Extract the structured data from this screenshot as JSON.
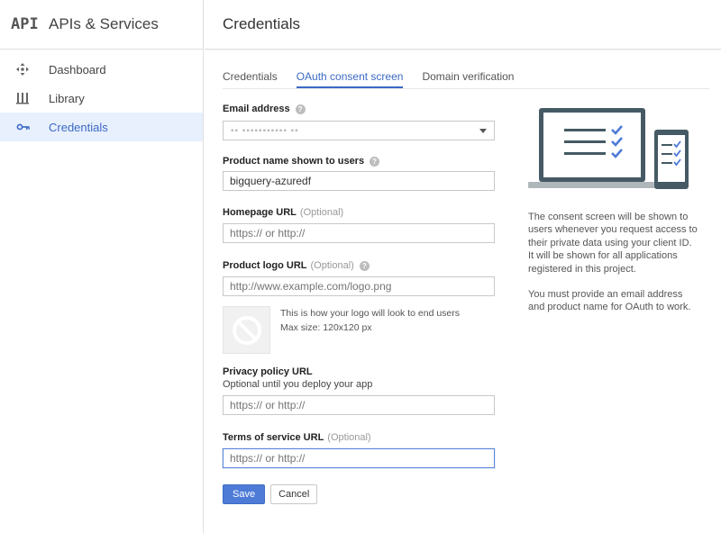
{
  "sidebar": {
    "logo": "API",
    "title": "APIs & Services",
    "items": [
      {
        "label": "Dashboard",
        "icon": "dashboard-icon",
        "active": false
      },
      {
        "label": "Library",
        "icon": "library-icon",
        "active": false
      },
      {
        "label": "Credentials",
        "icon": "key-icon",
        "active": true
      }
    ]
  },
  "header": {
    "title": "Credentials"
  },
  "tabs": [
    {
      "label": "Credentials",
      "active": false
    },
    {
      "label": "OAuth consent screen",
      "active": true
    },
    {
      "label": "Domain verification",
      "active": false
    }
  ],
  "form": {
    "email": {
      "label": "Email address",
      "value": "▪▪ ▪▪▪▪▪▪▪▪▪▪▪ ▪▪"
    },
    "product_name": {
      "label": "Product name shown to users",
      "value": "bigquery-azuredf"
    },
    "homepage": {
      "label": "Homepage URL",
      "optional": "(Optional)",
      "placeholder": "https:// or http://"
    },
    "logo_url": {
      "label": "Product logo URL",
      "optional": "(Optional)",
      "placeholder": "http://www.example.com/logo.png"
    },
    "logo_preview": {
      "line1": "This is how your logo will look to end users",
      "line2": "Max size: 120x120 px"
    },
    "privacy": {
      "label": "Privacy policy URL",
      "sublabel": "Optional until you deploy your app",
      "placeholder": "https:// or http://"
    },
    "terms": {
      "label": "Terms of service URL",
      "optional": "(Optional)",
      "placeholder": "https:// or http://"
    },
    "save_label": "Save",
    "cancel_label": "Cancel"
  },
  "info": {
    "p1": "The consent screen will be shown to users whenever you request access to their private data using your client ID. It will be shown for all applications registered in this project.",
    "p2": "You must provide an email address and product name for OAuth to work."
  },
  "colors": {
    "accent": "#3b69c4",
    "save_button": "#4d7bd6",
    "active_nav_bg": "#e8f0fe"
  }
}
